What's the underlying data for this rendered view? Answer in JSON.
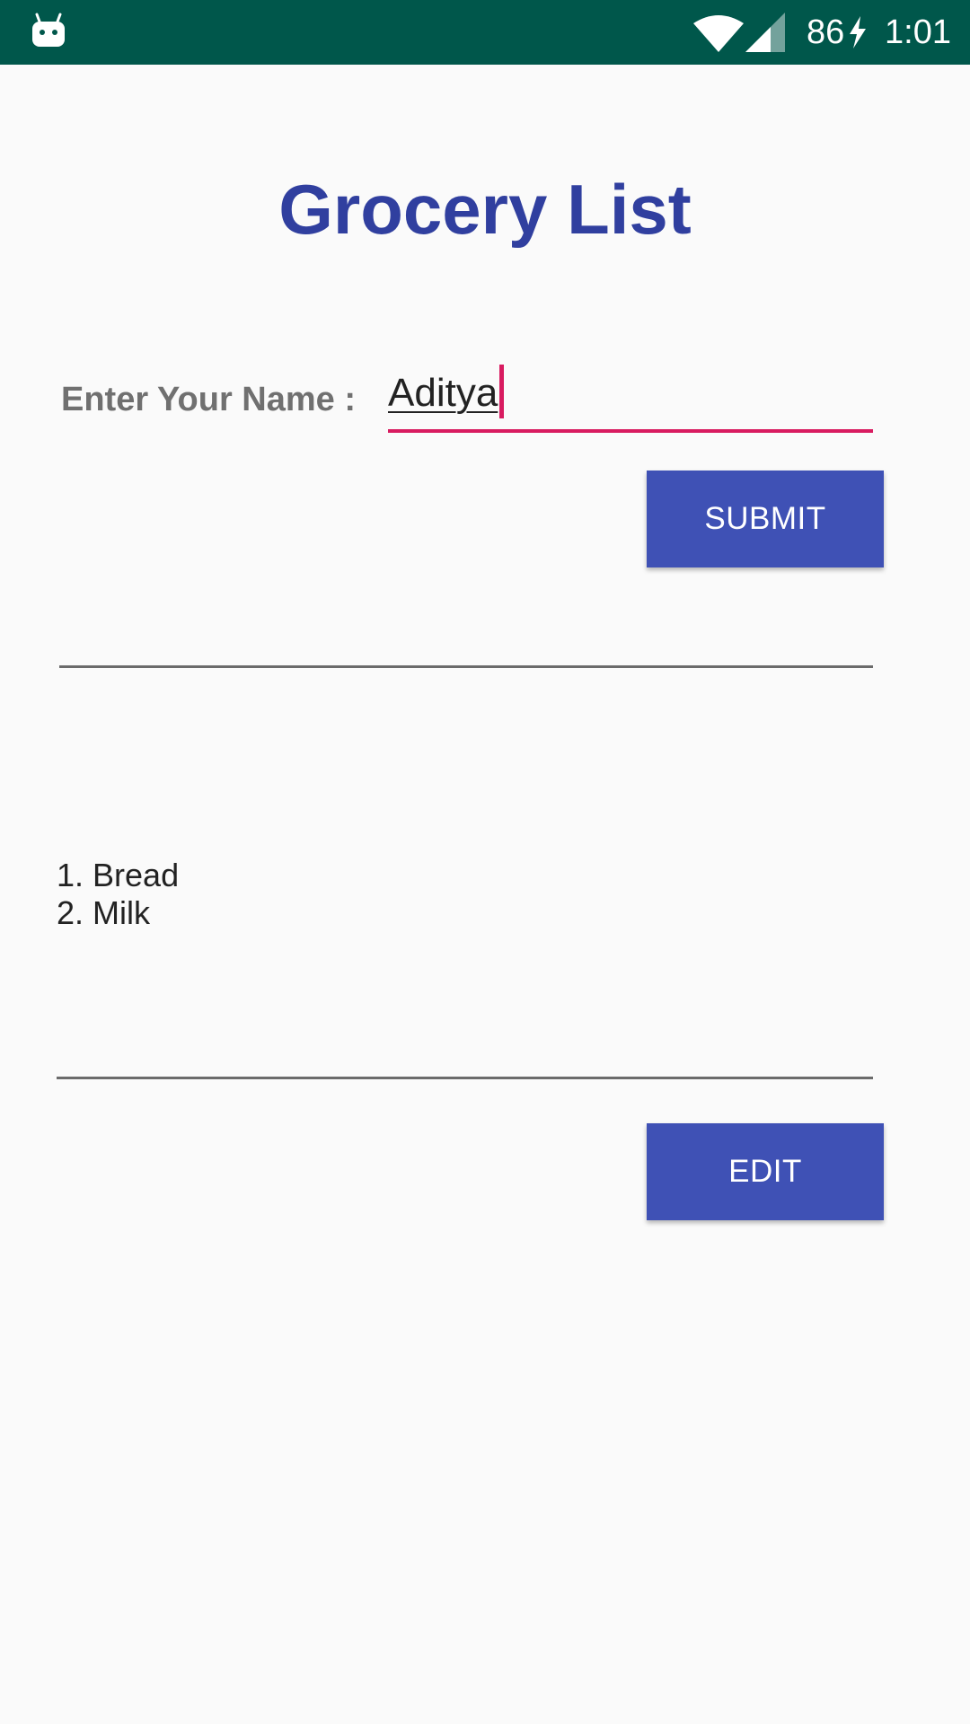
{
  "status_bar": {
    "battery_level": "86",
    "time": "1:01",
    "background_color": "#00574b"
  },
  "main": {
    "title": "Grocery List",
    "title_color": "#303f9f",
    "name_label": "Enter Your Name :",
    "name_value": "Aditya",
    "input_accent_color": "#d81b60",
    "submit_label": "SUBMIT",
    "edit_label": "EDIT",
    "button_color": "#3f51b5",
    "grocery_items": [
      "1. Bread",
      "2. Milk"
    ]
  },
  "icons": {
    "app": "android-notification-icon",
    "wifi": "wifi-icon",
    "signal": "cell-signal-icon",
    "charging": "charging-bolt-icon"
  }
}
